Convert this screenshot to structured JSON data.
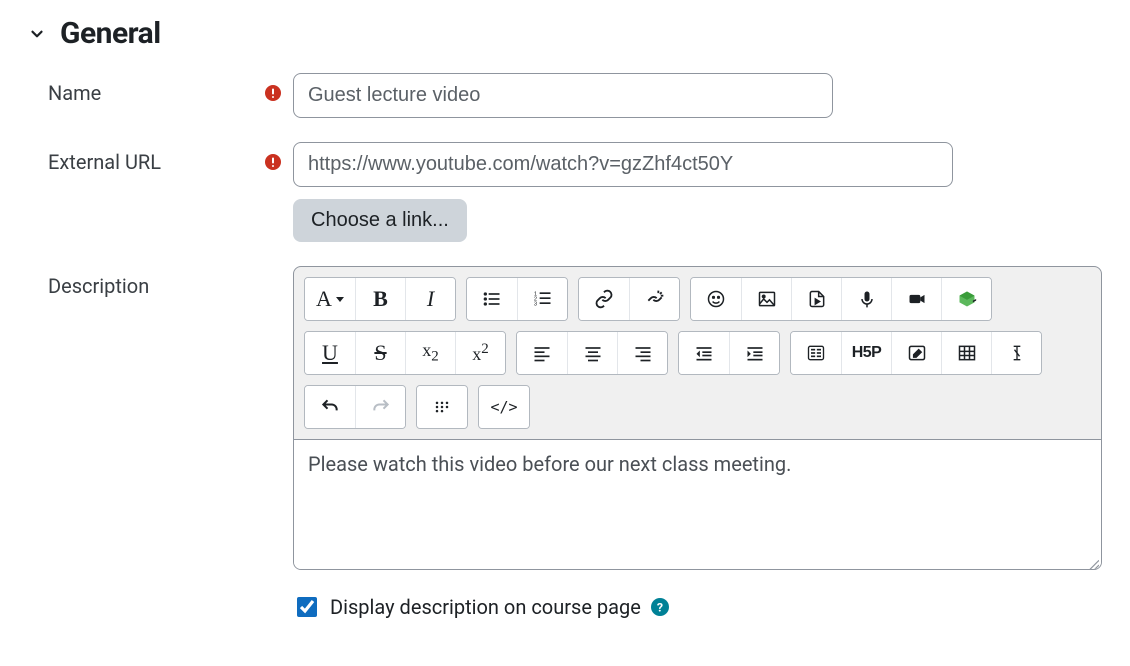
{
  "section": {
    "title": "General"
  },
  "fields": {
    "name": {
      "label": "Name",
      "value": "Guest lecture video"
    },
    "external_url": {
      "label": "External URL",
      "value": "https://www.youtube.com/watch?v=gzZhf4ct50Y",
      "choose_link": "Choose a link..."
    },
    "description": {
      "label": "Description",
      "content": "Please watch this video before our next class meeting."
    },
    "display_desc": {
      "label": "Display description on course page",
      "checked": true
    }
  },
  "editor_toolbar": {
    "paragraph_glyph": "A",
    "bold_glyph": "B",
    "italic_glyph": "I",
    "underline_glyph": "U",
    "strike_glyph": "S",
    "sub_glyph": "x",
    "sup_glyph": "x",
    "h5p_glyph": "H5P",
    "code_glyph": "</>"
  }
}
